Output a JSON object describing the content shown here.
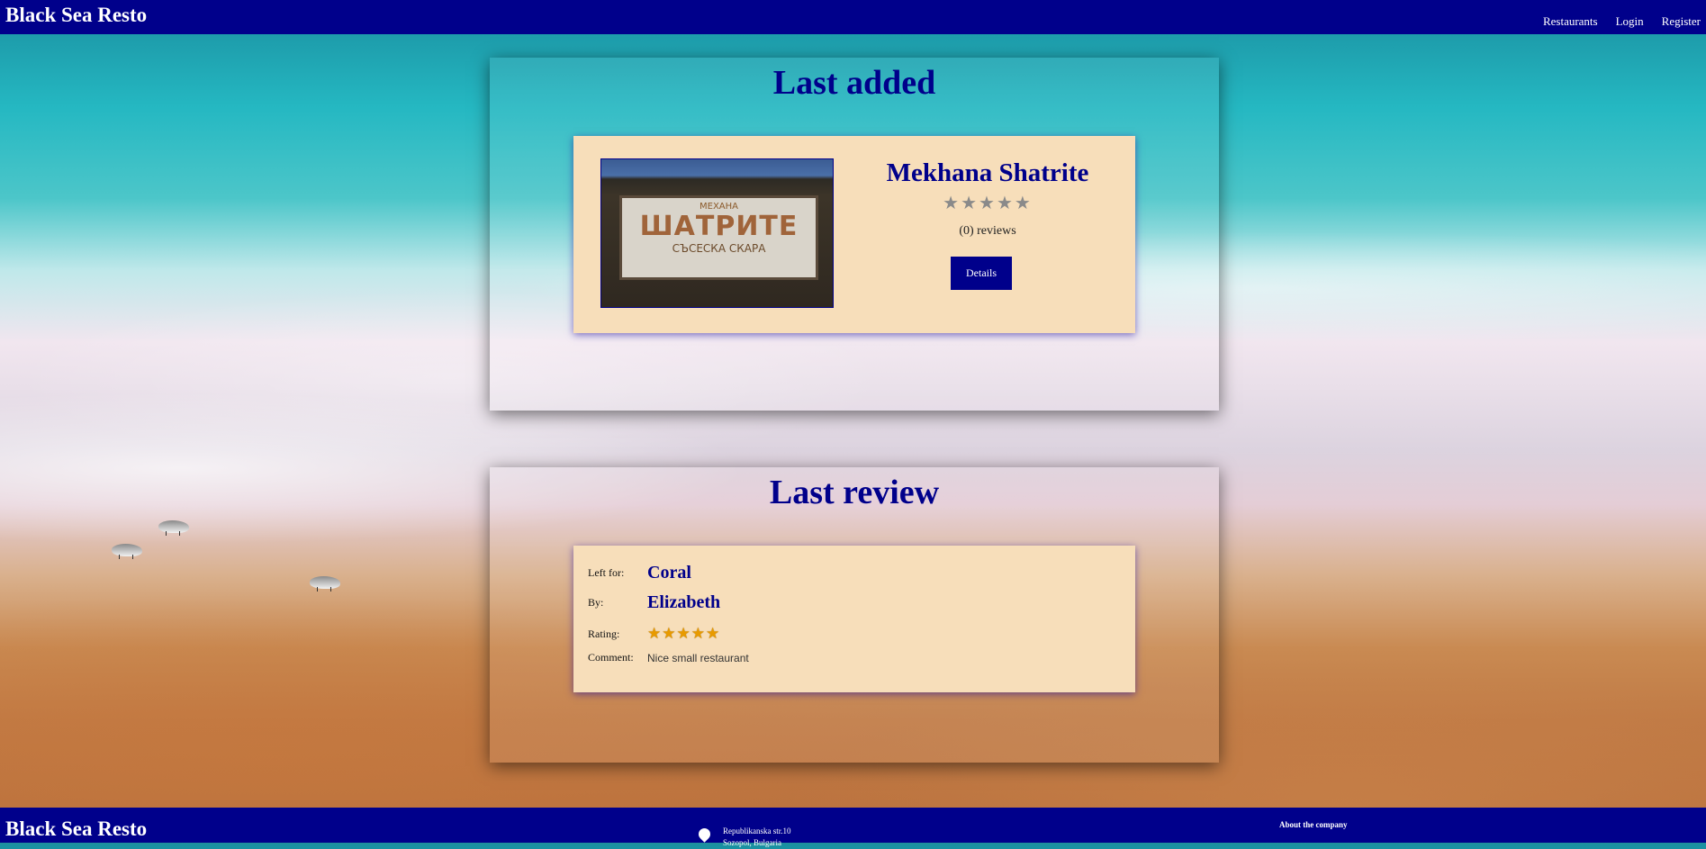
{
  "header": {
    "brand": "Black Sea Resto",
    "nav": [
      "Restaurants",
      "Login",
      "Register"
    ]
  },
  "last_added": {
    "title": "Last added",
    "restaurant": {
      "name": "Mekhana Shatrite",
      "rating_stars": "★★★★★",
      "rating_value": 0,
      "reviews_text": "(0) reviews",
      "details_label": "Details",
      "image_sign": {
        "top": "МЕХАНА",
        "main": "ШАТРИТЕ",
        "bottom": "СЪСЕСКА СКАРА"
      }
    }
  },
  "last_review": {
    "title": "Last review",
    "left_for_label": "Left for:",
    "left_for_value": "Coral",
    "by_label": "By:",
    "by_value": "Elizabeth",
    "rating_label": "Rating:",
    "rating_stars": "★★★★★",
    "rating_value": 5,
    "comment_label": "Comment:",
    "comment_value": "Nice small restaurant"
  },
  "footer": {
    "brand": "Black Sea Resto",
    "address_line1": "Republikanska str.10",
    "address_line2": "Sozopol, Bulgaria",
    "about": "About the company"
  },
  "colors": {
    "navy": "#00008b",
    "card": "#f7deba",
    "star_gold": "#e89a00",
    "star_gray": "#8a8a8a"
  }
}
